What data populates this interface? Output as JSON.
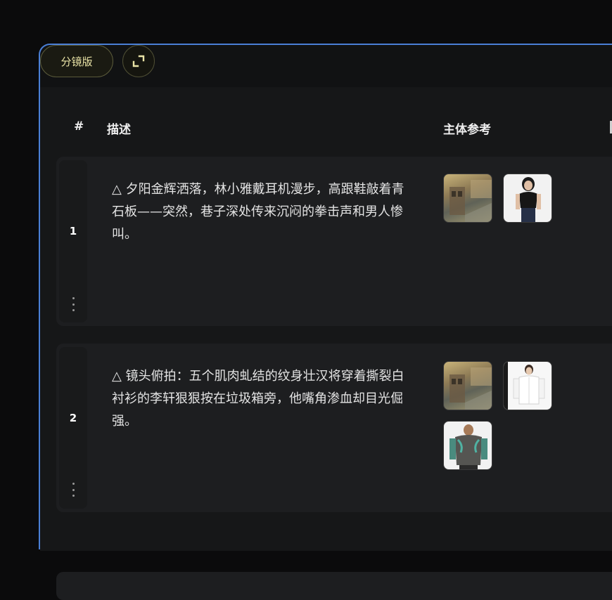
{
  "toolbar": {
    "storyboard_label": "分镜版",
    "expand_icon": "expand-icon"
  },
  "table": {
    "headers": [
      "#",
      "描述",
      "主体参考"
    ],
    "rows": [
      {
        "num": "1",
        "description": "△ 夕阳金辉洒落，林小雅戴耳机漫步，高跟鞋敲着青石板——突然，巷子深处传来沉闷的拳击声和男人惨叫。",
        "refs": [
          "alley-scene-thumbnail",
          "woman-black-outfit-thumbnail"
        ]
      },
      {
        "num": "2",
        "description": "△ 镜头俯拍：五个肌肉虬结的纹身壮汉将穿着撕裂白衬衫的李轩狠狠按在垃圾箱旁，他嘴角渗血却目光倔强。",
        "refs": [
          "alley-scene-thumbnail",
          "man-white-shirt-thumbnail",
          "tattooed-man-thumbnail"
        ]
      }
    ]
  },
  "colors": {
    "frame_border": "#4a7fd6",
    "pill_text": "#e9e3a6",
    "background": "#0b0b0c"
  }
}
